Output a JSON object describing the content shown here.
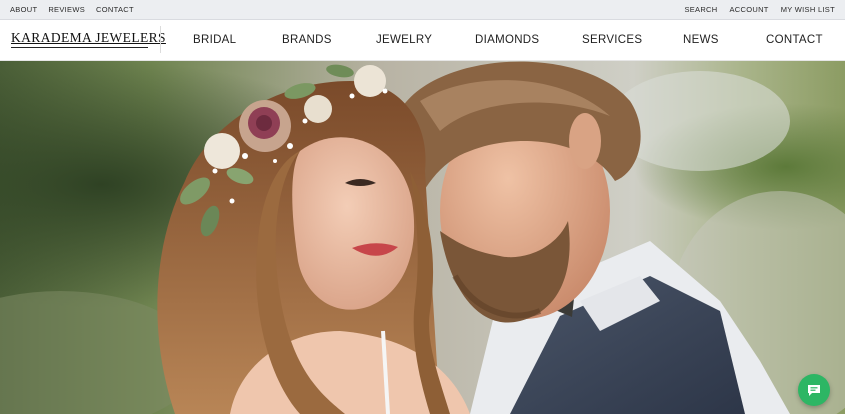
{
  "utility": {
    "left_links": [
      "ABOUT",
      "REVIEWS",
      "CONTACT"
    ],
    "right_links": [
      "SEARCH",
      "ACCOUNT",
      "MY WISH LIST"
    ]
  },
  "brand": {
    "name": "KARADEMA JEWELERS"
  },
  "nav": [
    "BRIDAL",
    "BRANDS",
    "JEWELRY",
    "DIAMONDS",
    "SERVICES",
    "NEWS",
    "CONTACT"
  ],
  "chat": {
    "icon": "chat-bubble-icon",
    "color": "#2db664"
  }
}
